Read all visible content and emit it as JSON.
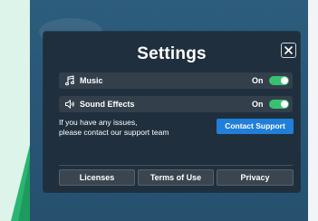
{
  "dialog": {
    "title": "Settings",
    "close_icon": "close-icon"
  },
  "settings": [
    {
      "label": "Music",
      "state": "On",
      "icon": "music-note-icon",
      "enabled": true
    },
    {
      "label": "Sound Effects",
      "state": "On",
      "icon": "speaker-icon",
      "enabled": true
    }
  ],
  "support": {
    "line1": "If you have any issues,",
    "line2": "please contact our support team",
    "button_label": "Contact Support"
  },
  "footer": {
    "licenses_label": "Licenses",
    "terms_label": "Terms of Use",
    "privacy_label": "Privacy"
  },
  "colors": {
    "accent_blue": "#1f7fd9",
    "toggle_green": "#38c172",
    "panel": "#1f2f3d"
  }
}
